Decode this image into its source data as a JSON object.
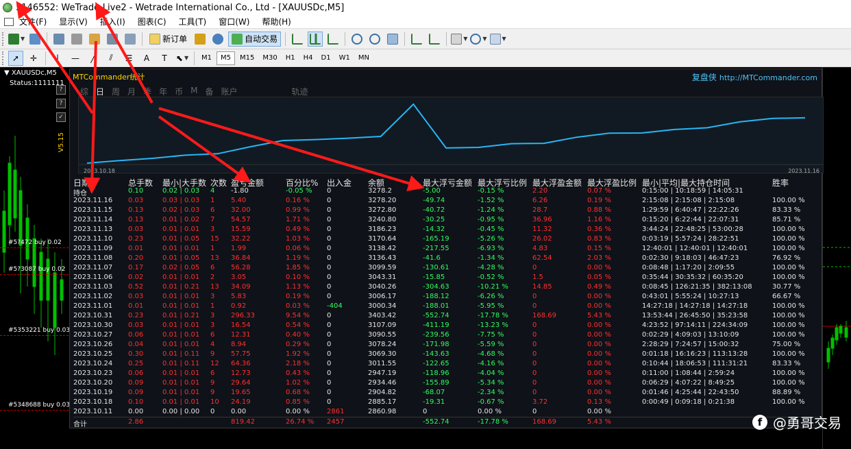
{
  "window": {
    "title": "5146552: WeTrade-Live2 - Wetrade International Co., Ltd - [XAUUSDc,M5]"
  },
  "menu": [
    "文件(F)",
    "显示(V)",
    "插入(I)",
    "图表(C)",
    "工具(T)",
    "窗口(W)",
    "帮助(H)"
  ],
  "toolbar": {
    "new_order": "新订单",
    "auto_trading": "自动交易"
  },
  "timeframes": [
    "M1",
    "M5",
    "M15",
    "M30",
    "H1",
    "H4",
    "D1",
    "W1",
    "MN"
  ],
  "active_timeframe": "M5",
  "chart": {
    "symbol": "XAUUSDc,M5",
    "status": "Status:1111111",
    "order_labels": [
      "#5?472 buy 0.02",
      "#5?3087 buy 0.02",
      "#5353221 buy 0.03",
      "#5348688 buy 0.03"
    ]
  },
  "panel": {
    "title": "MTCommander统计",
    "brand_cn": "复盘侠",
    "url": "http://MTCommander.com",
    "version": "V5.15",
    "side_buttons": [
      "?",
      "?",
      "✓"
    ],
    "tabs": [
      "综",
      "日",
      "周",
      "月",
      "季",
      "年",
      "币",
      "M",
      "备",
      "账户",
      "轨迹"
    ],
    "active_tab": "日",
    "equity_start_label": "2023.10.18",
    "equity_end_label": "2023.11.16",
    "equity_curve": [
      2860.98,
      2885.17,
      2904.82,
      2934.46,
      2947.19,
      3011.55,
      3069.3,
      3078.24,
      3090.55,
      3107.09,
      3403.42,
      3000.34,
      3006.17,
      3040.26,
      3043.31,
      3099.59,
      3136.43,
      3138.42,
      3170.64,
      3186.23,
      3240.8,
      3272.8,
      3278.2
    ],
    "columns": [
      "日期",
      "总手数",
      "最小|大手数",
      "次数",
      "盈亏金额",
      "百分比%",
      "出入金",
      "余额",
      "最大浮亏金额",
      "最大浮亏比例",
      "最大浮盈金额",
      "最大浮盈比例",
      "最小|平均|最大持仓时间",
      "胜率"
    ],
    "position_row": [
      "持仓",
      "0.10",
      "0.02 | 0.03",
      "4",
      "-1.80",
      "-0.05 %",
      "0",
      "3278.2",
      "-5.00",
      "-0.15 %",
      "2.20",
      "0.07 %",
      "0:15:00 | 10:18:59 | 14:05:31",
      ""
    ],
    "rows": [
      [
        "2023.11.16",
        "0.03",
        "0.03 | 0.03",
        "1",
        "5.40",
        "0.16 %",
        "0",
        "3278.20",
        "-49.74",
        "-1.52 %",
        "6.26",
        "0.19 %",
        "2:15:08 | 2:15:08 | 2:15:08",
        "100.00 %"
      ],
      [
        "2023.11.15",
        "0.13",
        "0.02 | 0.03",
        "6",
        "32.00",
        "0.99 %",
        "0",
        "3272.80",
        "-40.72",
        "-1.24 %",
        "28.7",
        "0.88 %",
        "1:29:59 | 6:40:47 | 22:22:26",
        "83.33 %"
      ],
      [
        "2023.11.14",
        "0.13",
        "0.01 | 0.02",
        "7",
        "54.57",
        "1.71 %",
        "0",
        "3240.80",
        "-30.25",
        "-0.95 %",
        "36.96",
        "1.16 %",
        "0:15:20 | 6:22:44 | 22:07:31",
        "85.71 %"
      ],
      [
        "2023.11.13",
        "0.03",
        "0.01 | 0.01",
        "3",
        "15.59",
        "0.49 %",
        "0",
        "3186.23",
        "-14.32",
        "-0.45 %",
        "11.32",
        "0.36 %",
        "3:44:24 | 22:48:25 | 53:00:28",
        "100.00 %"
      ],
      [
        "2023.11.10",
        "0.23",
        "0.01 | 0.05",
        "15",
        "32.22",
        "1.03 %",
        "0",
        "3170.64",
        "-165.19",
        "-5.26 %",
        "26.02",
        "0.83 %",
        "0:03:19 | 5:57:24 | 28:22:51",
        "100.00 %"
      ],
      [
        "2023.11.09",
        "0.01",
        "0.01 | 0.01",
        "1",
        "1.99",
        "0.06 %",
        "0",
        "3138.42",
        "-217.55",
        "-6.93 %",
        "4.83",
        "0.15 %",
        "12:40:01 | 12:40:01 | 12:40:01",
        "100.00 %"
      ],
      [
        "2023.11.08",
        "0.20",
        "0.01 | 0.05",
        "13",
        "36.84",
        "1.19 %",
        "0",
        "3136.43",
        "-41.6",
        "-1.34 %",
        "62.54",
        "2.03 %",
        "0:02:30 | 9:18:03 | 46:47:23",
        "76.92 %"
      ],
      [
        "2023.11.07",
        "0.17",
        "0.02 | 0.05",
        "6",
        "56.28",
        "1.85 %",
        "0",
        "3099.59",
        "-130.61",
        "-4.28 %",
        "0",
        "0.00 %",
        "0:08:48 | 1:17:20 | 2:09:55",
        "100.00 %"
      ],
      [
        "2023.11.06",
        "0.02",
        "0.01 | 0.01",
        "2",
        "3.05",
        "0.10 %",
        "0",
        "3043.31",
        "-15.85",
        "-0.52 %",
        "1.5",
        "0.05 %",
        "0:35:44 | 30:35:32 | 60:35:20",
        "100.00 %"
      ],
      [
        "2023.11.03",
        "0.52",
        "0.01 | 0.21",
        "13",
        "34.09",
        "1.13 %",
        "0",
        "3040.26",
        "-304.63",
        "-10.21 %",
        "14.85",
        "0.49 %",
        "0:08:45 | 126:21:35 | 382:13:08",
        "30.77 %"
      ],
      [
        "2023.11.02",
        "0.03",
        "0.01 | 0.01",
        "3",
        "5.83",
        "0.19 %",
        "0",
        "3006.17",
        "-188.12",
        "-6.26 %",
        "0",
        "0.00 %",
        "0:43:01 | 5:55:24 | 10:27:13",
        "66.67 %"
      ],
      [
        "2023.11.01",
        "0.01",
        "0.01 | 0.01",
        "1",
        "0.92",
        "0.03 %",
        "-404",
        "3000.34",
        "-188.01",
        "-5.95 %",
        "0",
        "0.00 %",
        "14:27:18 | 14:27:18 | 14:27:18",
        "100.00 %"
      ],
      [
        "2023.10.31",
        "0.23",
        "0.01 | 0.21",
        "3",
        "296.33",
        "9.54 %",
        "0",
        "3403.42",
        "-552.74",
        "-17.78 %",
        "168.69",
        "5.43 %",
        "13:53:44 | 26:45:50 | 35:23:58",
        "100.00 %"
      ],
      [
        "2023.10.30",
        "0.03",
        "0.01 | 0.01",
        "3",
        "16.54",
        "0.54 %",
        "0",
        "3107.09",
        "-411.19",
        "-13.23 %",
        "0",
        "0.00 %",
        "4:23:52 | 97:14:11 | 224:34:09",
        "100.00 %"
      ],
      [
        "2023.10.27",
        "0.06",
        "0.01 | 0.01",
        "6",
        "12.31",
        "0.40 %",
        "0",
        "3090.55",
        "-239.56",
        "-7.75 %",
        "0",
        "0.00 %",
        "0:02:29 | 4:09:03 | 13:10:09",
        "100.00 %"
      ],
      [
        "2023.10.26",
        "0.04",
        "0.01 | 0.01",
        "4",
        "8.94",
        "0.29 %",
        "0",
        "3078.24",
        "-171.98",
        "-5.59 %",
        "0",
        "0.00 %",
        "2:28:29 | 7:24:57 | 15:00:32",
        "75.00 %"
      ],
      [
        "2023.10.25",
        "0.30",
        "0.01 | 0.11",
        "9",
        "57.75",
        "1.92 %",
        "0",
        "3069.30",
        "-143.63",
        "-4.68 %",
        "0",
        "0.00 %",
        "0:01:18 | 16:16:23 | 113:13:28",
        "100.00 %"
      ],
      [
        "2023.10.24",
        "0.25",
        "0.01 | 0.11",
        "12",
        "64.36",
        "2.18 %",
        "0",
        "3011.55",
        "-122.65",
        "-4.16 %",
        "0",
        "0.00 %",
        "0:10:44 | 18:06:53 | 111:31:21",
        "83.33 %"
      ],
      [
        "2023.10.23",
        "0.06",
        "0.01 | 0.01",
        "6",
        "12.73",
        "0.43 %",
        "0",
        "2947.19",
        "-118.96",
        "-4.04 %",
        "0",
        "0.00 %",
        "0:11:00 | 1:08:44 | 2:59:24",
        "100.00 %"
      ],
      [
        "2023.10.20",
        "0.09",
        "0.01 | 0.01",
        "9",
        "29.64",
        "1.02 %",
        "0",
        "2934.46",
        "-155.89",
        "-5.34 %",
        "0",
        "0.00 %",
        "0:06:29 | 4:07:22 | 8:49:25",
        "100.00 %"
      ],
      [
        "2023.10.19",
        "0.09",
        "0.01 | 0.01",
        "9",
        "19.65",
        "0.68 %",
        "0",
        "2904.82",
        "-68.07",
        "-2.34 %",
        "0",
        "0.00 %",
        "0:01:46 | 4:25:44 | 22:43:50",
        "88.89 %"
      ],
      [
        "2023.10.18",
        "0.10",
        "0.01 | 0.01",
        "10",
        "24.19",
        "0.85 %",
        "0",
        "2885.17",
        "-19.31",
        "-0.67 %",
        "3.72",
        "0.13 %",
        "0:00:49 | 0:09:18 | 0:21:38",
        "100.00 %"
      ],
      [
        "2023.10.11",
        "0.00",
        "0.00 | 0.00",
        "0",
        "0.00",
        "0.00 %",
        "2861",
        "2860.98",
        "0",
        "0.00 %",
        "0",
        "0.00 %",
        "",
        ""
      ]
    ],
    "total_row": [
      "合计",
      "2.86",
      "",
      "",
      "819.42",
      "26.74 %",
      "2457",
      "",
      "-552.74",
      "-17.78 %",
      "168.69",
      "5.43 %",
      "",
      ""
    ]
  },
  "watermark": "@勇哥交易",
  "colors": {
    "profit": "#ff3030",
    "loss": "#30ff60",
    "neutral": "#e6e6e6",
    "curve": "#29b6f6",
    "title": "#ffd400",
    "arrow": "#ff1a1a"
  }
}
